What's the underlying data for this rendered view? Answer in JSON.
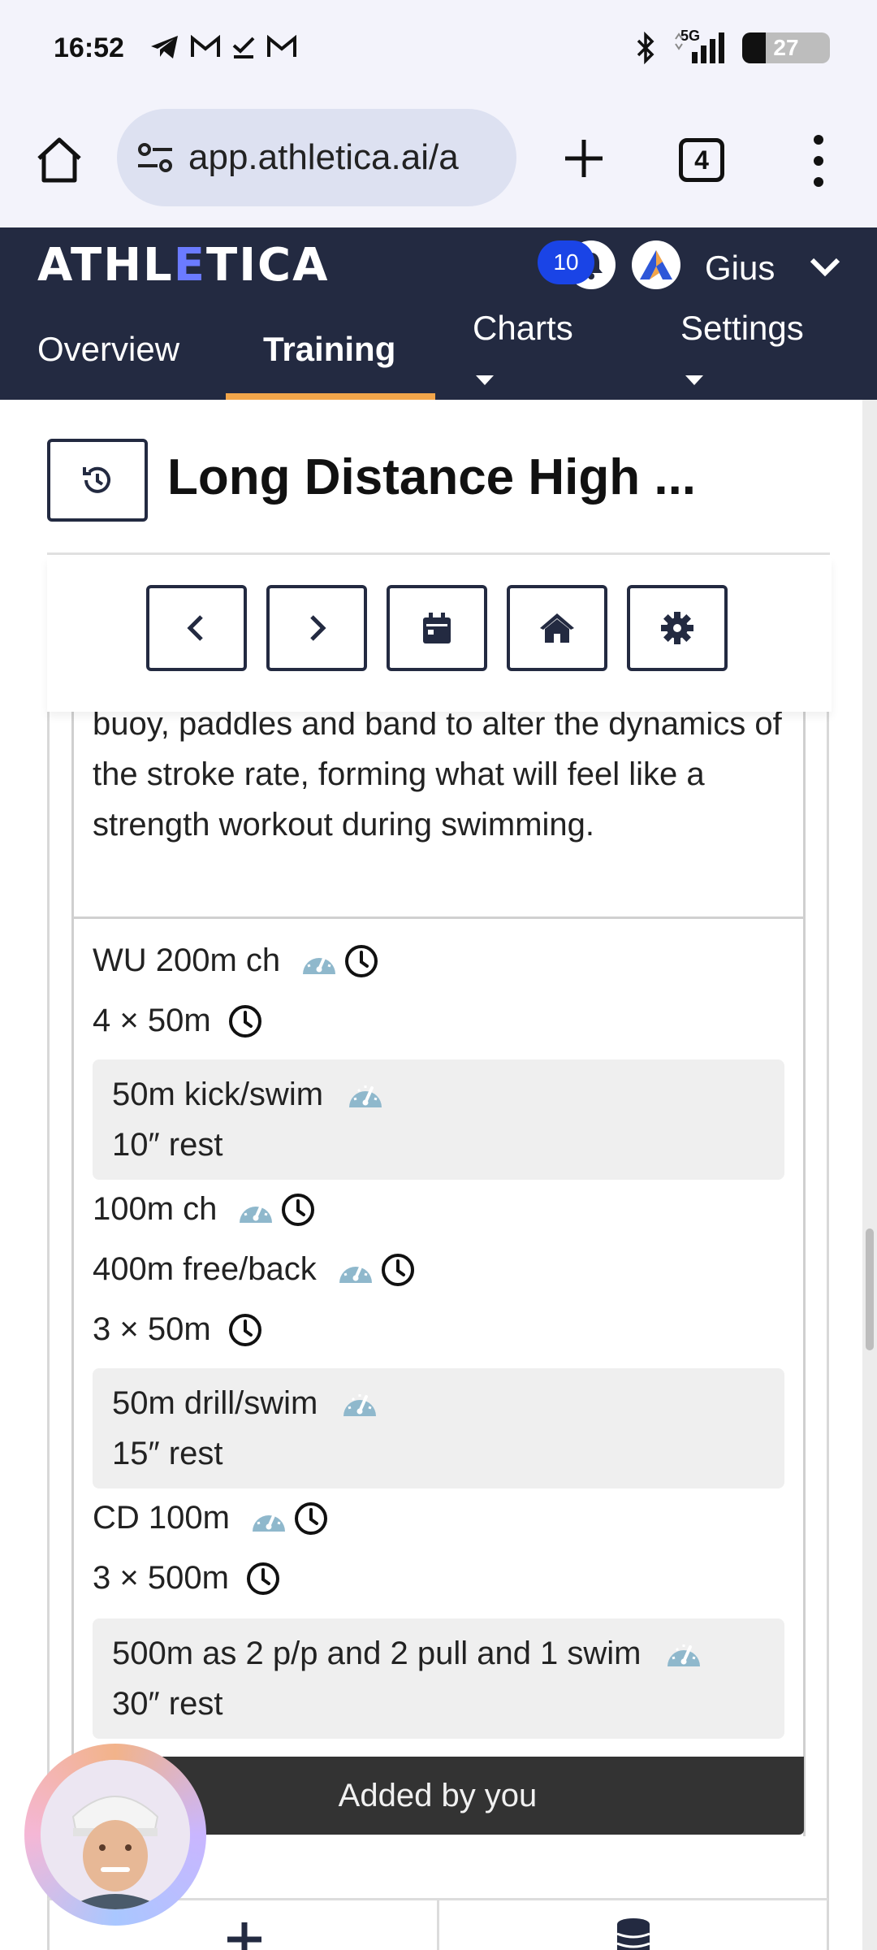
{
  "status_bar": {
    "time": "16:52",
    "network": "5G",
    "battery": "27",
    "battery_level": 0.27,
    "icons_left": [
      "telegram-icon",
      "gmail-icon",
      "check-download-icon",
      "gmail-icon"
    ],
    "icons_right": [
      "bluetooth-icon",
      "signal-icon",
      "battery-icon"
    ]
  },
  "browser": {
    "url": "app.athletica.ai/a",
    "tab_count": "4"
  },
  "app_header": {
    "logo_left": "ATHL",
    "logo_accent": "E",
    "logo_right": "TICA",
    "notification_count": "10",
    "user_name": "Gius"
  },
  "nav": {
    "tabs": [
      {
        "label": "Overview",
        "active": false,
        "dropdown": false
      },
      {
        "label": "Training",
        "active": true,
        "dropdown": false
      },
      {
        "label": "Charts",
        "active": false,
        "dropdown": true
      },
      {
        "label": "Settings",
        "active": false,
        "dropdown": true
      }
    ]
  },
  "workout": {
    "title": "Long Distance High ...",
    "description": "buoy, paddles and band to alter the dynamics of the stroke rate, forming what will feel like a strength workout during swimming.",
    "steps": {
      "wu": "WU 200m ch",
      "rep1": "4 × 50m",
      "rep1_detail": "50m kick/swim",
      "rep1_rest": "10″ rest",
      "ch100": "100m ch",
      "freeback": "400m free/back",
      "rep2": "3 × 50m",
      "rep2_detail": "50m drill/swim",
      "rep2_rest": "15″ rest",
      "cd": "CD 100m",
      "rep3": "3 × 500m",
      "rep3_detail": "500m as 2 p/p and 2 pull and 1 swim",
      "rep3_rest": "30″ rest"
    },
    "added_by": "Added by you"
  },
  "colors": {
    "header_bg": "#232a41",
    "tab_underline": "#f2a54a",
    "badge": "#1a44e6",
    "gauge": "#8fb8cc",
    "added_bar": "#333333"
  }
}
